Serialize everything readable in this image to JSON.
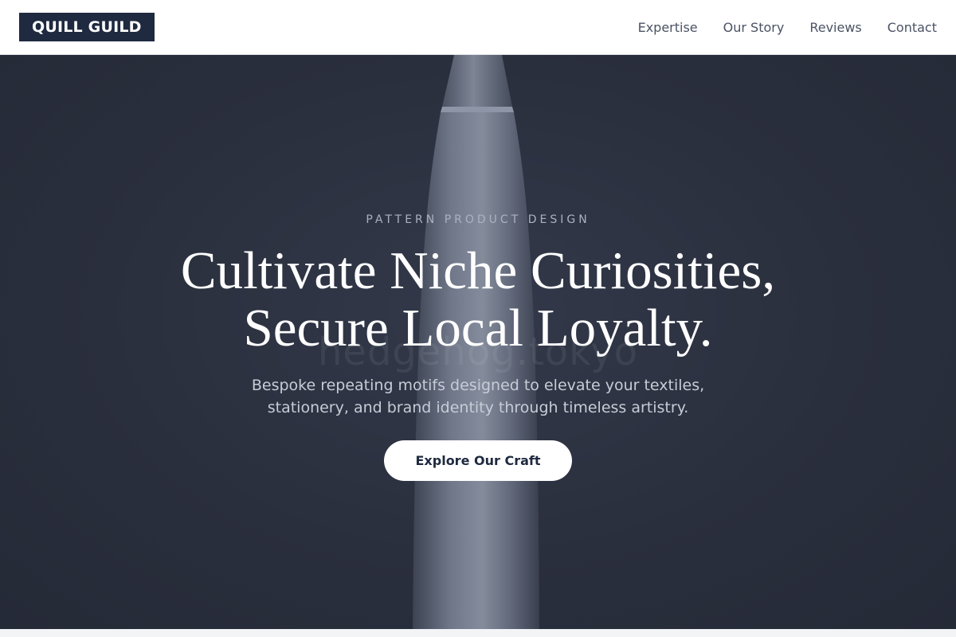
{
  "brand": {
    "name": "QUILL GUILD"
  },
  "nav": {
    "items": [
      {
        "label": "Expertise"
      },
      {
        "label": "Our Story"
      },
      {
        "label": "Reviews"
      },
      {
        "label": "Contact"
      }
    ]
  },
  "hero": {
    "eyebrow": "PATTERN PRODUCT DESIGN",
    "headline_line1": "Cultivate Niche Curiosities,",
    "headline_line2": "Secure Local Loyalty.",
    "subtext_line1": "Bespoke repeating motifs designed to elevate your textiles,",
    "subtext_line2": "stationery, and brand identity through timeless artistry.",
    "cta_label": "Explore Our Craft",
    "watermark": "hedgehog.tokyo"
  },
  "colors": {
    "logo_bg": "#1f2a40",
    "hero_bg": "#2a2f3d",
    "cta_bg": "#ffffff",
    "cta_text": "#1f2a40"
  }
}
